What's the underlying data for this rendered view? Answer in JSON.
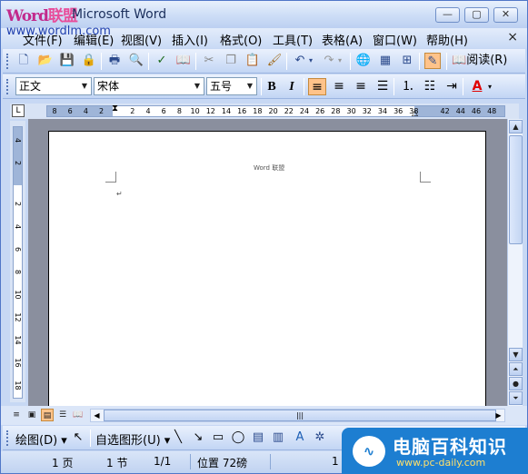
{
  "title": {
    "logo_text_a": "Word",
    "logo_text_b": "联盟",
    "app_title": "Microsoft Word",
    "watermark_url": "www.wordlm.com",
    "minimize": "—",
    "restore": "▢",
    "close": "✕"
  },
  "menu": {
    "items": [
      "文件(F)",
      "编辑(E)",
      "视图(V)",
      "插入(I)",
      "格式(O)",
      "工具(T)",
      "表格(A)",
      "窗口(W)",
      "帮助(H)"
    ],
    "close": "×"
  },
  "standard_toolbar": {
    "icons": [
      "new-doc-icon",
      "open-icon",
      "save-icon",
      "permission-icon",
      "print-icon",
      "print-preview-icon",
      "spelling-icon",
      "research-icon",
      "cut-icon",
      "copy-icon",
      "paste-icon",
      "format-painter-icon",
      "undo-icon",
      "redo-icon",
      "insert-hyperlink-icon",
      "tables-borders-icon",
      "insert-table-icon",
      "drawing-icon"
    ],
    "read_label": "阅读(R)"
  },
  "format_toolbar": {
    "style_value": "正文",
    "font_value": "宋体",
    "size_value": "五号",
    "bold": "B",
    "italic": "I",
    "align_active": "align-left"
  },
  "ruler": {
    "numbers": [
      "8",
      "6",
      "4",
      "2",
      "2",
      "4",
      "6",
      "8",
      "10",
      "12",
      "14",
      "16",
      "18",
      "20",
      "22",
      "24",
      "26",
      "28",
      "30",
      "32",
      "34",
      "36",
      "38",
      "42",
      "44",
      "46",
      "48"
    ],
    "tab_symbol": "L"
  },
  "vruler": {
    "numbers": [
      "4",
      "2",
      "2",
      "4",
      "6",
      "8",
      "10",
      "12",
      "14",
      "16",
      "18"
    ]
  },
  "document": {
    "header_text": "Word 联盟",
    "paragraph_mark": "↵"
  },
  "draw_toolbar": {
    "draw_label": "绘图(D)",
    "autoshapes_label": "自选图形(U)"
  },
  "status": {
    "page": "1 页",
    "section": "1 节",
    "page_of": "1/1",
    "position": "位置 72磅",
    "line": "1"
  },
  "brand": {
    "name": "电脑百科知识",
    "url": "www.pc-daily.com"
  },
  "colors": {
    "accent_orange": "#ffc38a",
    "brand_blue": "#1d7ed1",
    "font_color_red": "#e00000"
  }
}
